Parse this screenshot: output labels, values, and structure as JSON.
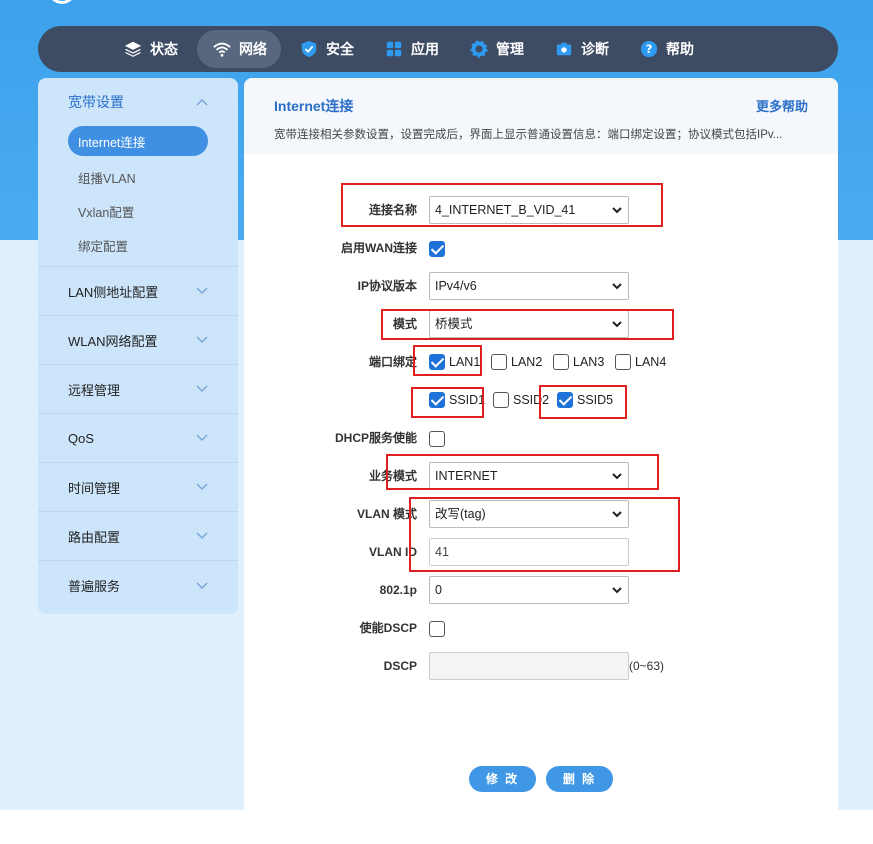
{
  "nav": {
    "items": [
      {
        "label": "状态",
        "icon": "layers-icon"
      },
      {
        "label": "网络",
        "icon": "wifi-icon",
        "active": true
      },
      {
        "label": "安全",
        "icon": "shield-icon"
      },
      {
        "label": "应用",
        "icon": "grid-icon"
      },
      {
        "label": "管理",
        "icon": "gear-icon"
      },
      {
        "label": "诊断",
        "icon": "camera-icon"
      },
      {
        "label": "帮助",
        "icon": "question-icon"
      }
    ]
  },
  "sidebar": {
    "open_group": "宽带设置",
    "sub_items": [
      "Internet连接",
      "组播VLAN",
      "Vxlan配置",
      "绑定配置"
    ],
    "groups": [
      "LAN侧地址配置",
      "WLAN网络配置",
      "远程管理",
      "QoS",
      "时间管理",
      "路由配置",
      "普遍服务"
    ]
  },
  "panel": {
    "title": "Internet连接",
    "help": "更多帮助",
    "desc": "宽带连接相关参数设置，设置完成后，界面上显示普通设置信息：端口绑定设置；协议模式包括IPv..."
  },
  "form": {
    "conn_name_label": "连接名称",
    "conn_name": "4_INTERNET_B_VID_41",
    "wan_enable_label": "启用WAN连接",
    "ip_version_label": "IP协议版本",
    "ip_version": "IPv4/v6",
    "mode_label": "模式",
    "mode": "桥模式",
    "port_bind_label": "端口绑定",
    "ports": [
      {
        "label": "LAN1",
        "checked": true
      },
      {
        "label": "LAN2",
        "checked": false
      },
      {
        "label": "LAN3",
        "checked": false
      },
      {
        "label": "LAN4",
        "checked": false
      }
    ],
    "ssids": [
      {
        "label": "SSID1",
        "checked": true
      },
      {
        "label": "SSID2",
        "checked": false
      },
      {
        "label": "SSID5",
        "checked": true
      }
    ],
    "dhcp_label": "DHCP服务使能",
    "service_mode_label": "业务模式",
    "service_mode": "INTERNET",
    "vlan_mode_label": "VLAN 模式",
    "vlan_mode": "改写(tag)",
    "vlan_id_label": "VLAN ID",
    "vlan_id": "41",
    "p8021_label": "802.1p",
    "p8021": "0",
    "dscp_enable_label": "使能DSCP",
    "dscp_label": "DSCP",
    "dscp_range": "(0~63)"
  },
  "buttons": {
    "modify": "修 改",
    "delete": "删 除"
  }
}
